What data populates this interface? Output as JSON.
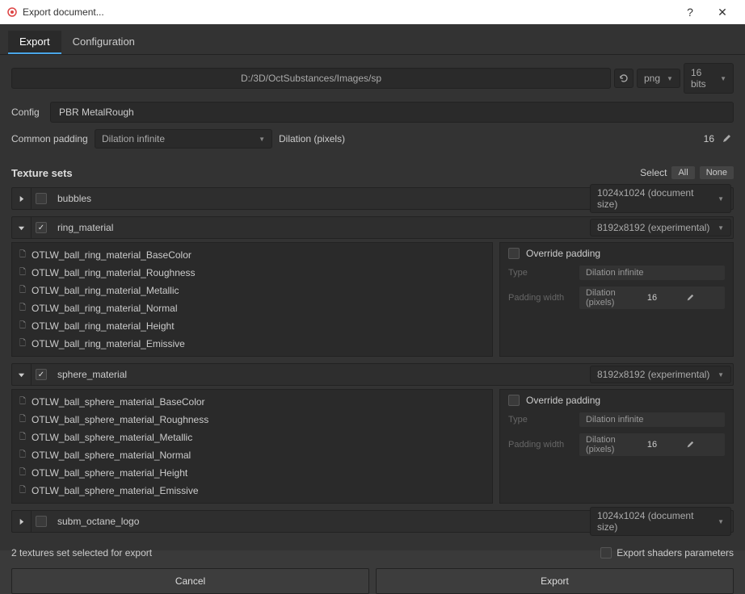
{
  "window": {
    "title": "Export document..."
  },
  "tabs": {
    "export": "Export",
    "configuration": "Configuration"
  },
  "path": {
    "value": "D:/3D/OctSubstances/Images/sp",
    "format": "png",
    "bits": "16 bits"
  },
  "config": {
    "label": "Config",
    "value": "PBR MetalRough"
  },
  "padding": {
    "label": "Common padding",
    "mode": "Dilation infinite",
    "dilation_label": "Dilation (pixels)",
    "dilation_value": "16"
  },
  "textureSets": {
    "title": "Texture sets",
    "select_label": "Select",
    "all": "All",
    "none": "None"
  },
  "sets": [
    {
      "name": "bubbles",
      "size": "1024x1024 (document size)"
    },
    {
      "name": "ring_material",
      "size": "8192x8192 (experimental)"
    },
    {
      "name": "sphere_material",
      "size": "8192x8192 (experimental)"
    },
    {
      "name": "subm_octane_logo",
      "size": "1024x1024 (document size)"
    }
  ],
  "ringMaps": [
    "OTLW_ball_ring_material_BaseColor",
    "OTLW_ball_ring_material_Roughness",
    "OTLW_ball_ring_material_Metallic",
    "OTLW_ball_ring_material_Normal",
    "OTLW_ball_ring_material_Height",
    "OTLW_ball_ring_material_Emissive"
  ],
  "sphereMaps": [
    "OTLW_ball_sphere_material_BaseColor",
    "OTLW_ball_sphere_material_Roughness",
    "OTLW_ball_sphere_material_Metallic",
    "OTLW_ball_sphere_material_Normal",
    "OTLW_ball_sphere_material_Height",
    "OTLW_ball_sphere_material_Emissive"
  ],
  "override": {
    "title": "Override padding",
    "type_label": "Type",
    "type_value": "Dilation infinite",
    "width_label": "Padding width",
    "dilation": "Dilation (pixels)",
    "value": "16"
  },
  "footer": {
    "status": "2 textures set selected for export",
    "shader_label": "Export shaders parameters",
    "cancel": "Cancel",
    "export": "Export"
  }
}
